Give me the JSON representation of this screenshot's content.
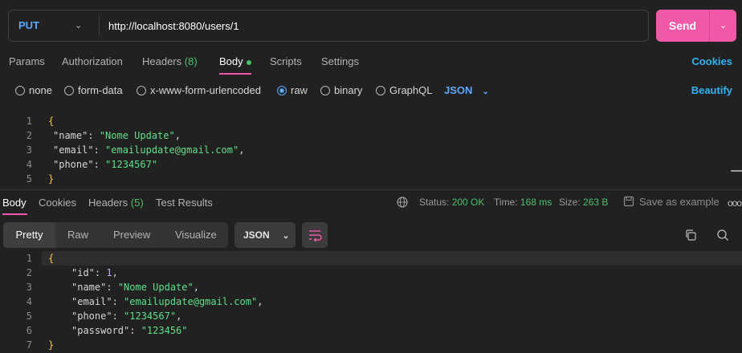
{
  "request": {
    "method": "PUT",
    "url": "http://localhost:8080/users/1",
    "send_label": "Send"
  },
  "request_tabs": [
    {
      "label": "Params"
    },
    {
      "label": "Authorization"
    },
    {
      "label": "Headers",
      "count": "(8)"
    },
    {
      "label": "Body"
    },
    {
      "label": "Scripts"
    },
    {
      "label": "Settings"
    }
  ],
  "cookies_label": "Cookies",
  "body_modes": [
    {
      "label": "none"
    },
    {
      "label": "form-data"
    },
    {
      "label": "x-www-form-urlencoded"
    },
    {
      "label": "raw"
    },
    {
      "label": "binary"
    },
    {
      "label": "GraphQL"
    }
  ],
  "selected_body_mode": "raw",
  "body_language": "JSON",
  "beautify_label": "Beautify",
  "request_body": {
    "line_numbers": [
      "1",
      "2",
      "3",
      "4",
      "5"
    ],
    "l1": "{",
    "l2_key": "\"name\"",
    "l2_val": "\"Nome Update\"",
    "l3_key": "\"email\"",
    "l3_val": "\"emailupdate@gmail.com\"",
    "l4_key": "\"phone\"",
    "l4_val": "\"1234567\"",
    "l5": "}"
  },
  "response_tabs": [
    {
      "label": "Body"
    },
    {
      "label": "Cookies"
    },
    {
      "label": "Headers",
      "count": "(5)"
    },
    {
      "label": "Test Results"
    }
  ],
  "response_meta": {
    "status_label": "Status:",
    "status_value": "200 OK",
    "time_label": "Time:",
    "time_value": "168 ms",
    "size_label": "Size:",
    "size_value": "263 B",
    "save_example": "Save as example",
    "more": "ooo"
  },
  "view_modes": [
    {
      "label": "Pretty"
    },
    {
      "label": "Raw"
    },
    {
      "label": "Preview"
    },
    {
      "label": "Visualize"
    }
  ],
  "response_format": "JSON",
  "response_body": {
    "line_numbers": [
      "1",
      "2",
      "3",
      "4",
      "5",
      "6",
      "7"
    ],
    "l1": "{",
    "l2_key": "\"id\"",
    "l2_val": "1",
    "l3_key": "\"name\"",
    "l3_val": "\"Nome Update\"",
    "l4_key": "\"email\"",
    "l4_val": "\"emailupdate@gmail.com\"",
    "l5_key": "\"phone\"",
    "l5_val": "\"1234567\"",
    "l6_key": "\"password\"",
    "l6_val": "\"123456\"",
    "l7": "}"
  },
  "colors": {
    "accent_pink": "#f159a8",
    "link_blue": "#2fb4f5",
    "method_blue": "#5aa9ff",
    "success_green": "#49c26a",
    "string_green": "#5ee08a"
  }
}
